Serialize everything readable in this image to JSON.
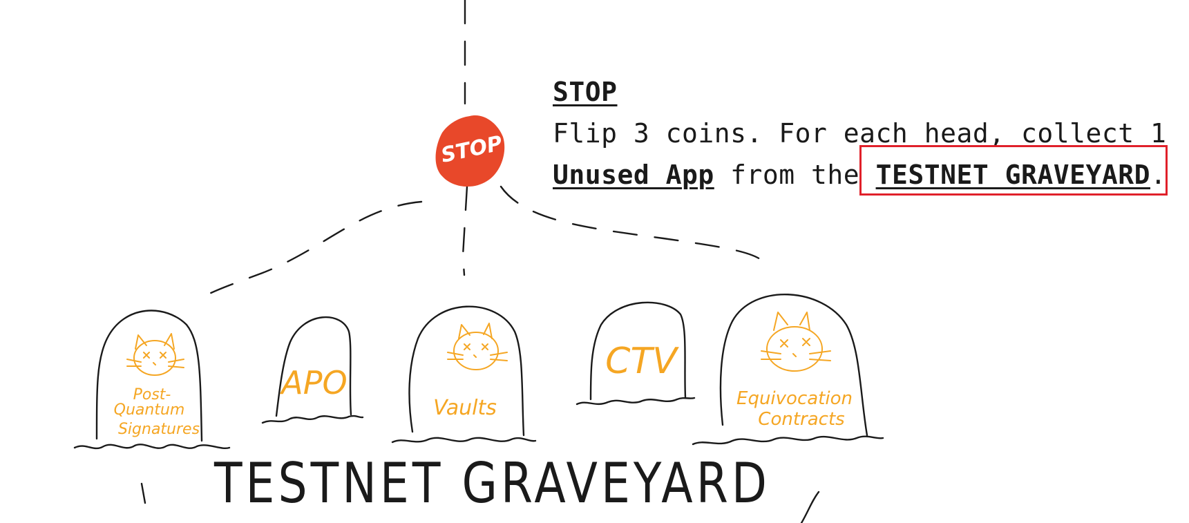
{
  "card": {
    "title": "STOP",
    "line1": "Flip 3 coins. For each head, collect 1",
    "link_unused_app": "Unused App",
    "mid_text": " from the ",
    "link_graveyard": "TESTNET GRAVEYARD",
    "end_punct": "."
  },
  "stop_sign": {
    "label": "STOP",
    "color": "#e8482a"
  },
  "tombstones": [
    {
      "label_lines": [
        "Post-",
        "Quantum",
        "Signatures"
      ],
      "has_cat": true
    },
    {
      "label_lines": [
        "APO"
      ],
      "has_cat": false
    },
    {
      "label_lines": [
        "Vaults"
      ],
      "has_cat": true
    },
    {
      "label_lines": [
        "CTV"
      ],
      "has_cat": false
    },
    {
      "label_lines": [
        "Equivocation",
        "Contracts"
      ],
      "has_cat": true
    }
  ],
  "graveyard_label": "TESTNET GRAVEYARD",
  "colors": {
    "accent": "#f5a623",
    "highlight": "#e0202a",
    "ink": "#1a1a1a"
  }
}
